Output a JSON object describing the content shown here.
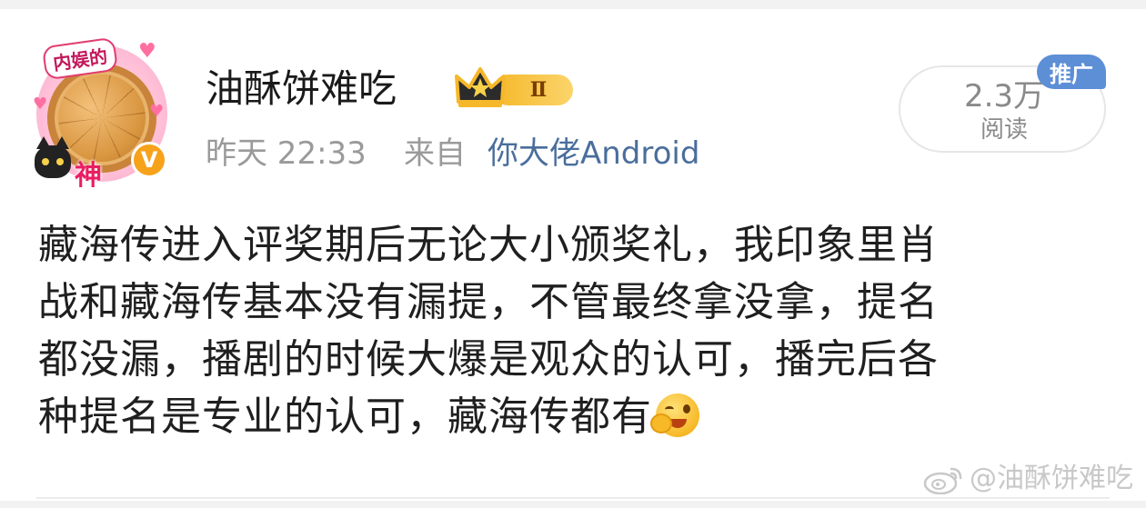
{
  "post": {
    "avatar": {
      "ribbon_text": "内娱的",
      "frame_text": "神",
      "verified_badge": "V"
    },
    "username": "油酥饼难吃",
    "level_badge": "Ⅱ",
    "time": "昨天 22:33",
    "from_label": "来自",
    "source": "你大佬Android",
    "read_count": "2.3万",
    "read_label": "阅读",
    "promo_label": "推广",
    "body_lines": [
      "藏海传进入评奖期后无论大小颁奖礼，我印象里肖",
      "战和藏海传基本没有漏提，不管最终拿没拿，提名",
      "都没漏，播剧的时候大爆是观众的认可，播完后各",
      "种提名是专业的认可，藏海传都有"
    ],
    "watermark": "@油酥饼难吃"
  },
  "colors": {
    "link_blue": "#4a6e9c",
    "promo_blue": "#5d8fd6",
    "meta_gray": "#9a9a9a",
    "badge_gold": "#f5b82a",
    "verified_orange": "#f7a21b"
  }
}
